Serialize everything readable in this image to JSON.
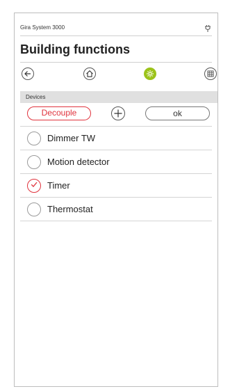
{
  "app": {
    "system_title": "Gira System 3000",
    "sys_icon": "plug-icon"
  },
  "page": {
    "title": "Building functions"
  },
  "nav": [
    {
      "name": "back-icon",
      "active": false
    },
    {
      "name": "home-icon",
      "active": false
    },
    {
      "name": "gear-icon",
      "active": true,
      "accent": "#9cc31a"
    },
    {
      "name": "grid-icon",
      "active": false
    }
  ],
  "section": {
    "title": "Devices"
  },
  "actions": {
    "decouple_label": "Decouple",
    "ok_label": "ok",
    "accent": "#e0323c"
  },
  "devices": [
    {
      "label": "Dimmer TW",
      "checked": false
    },
    {
      "label": "Motion detector",
      "checked": false
    },
    {
      "label": "Timer",
      "checked": true
    },
    {
      "label": "Thermostat",
      "checked": false
    }
  ]
}
